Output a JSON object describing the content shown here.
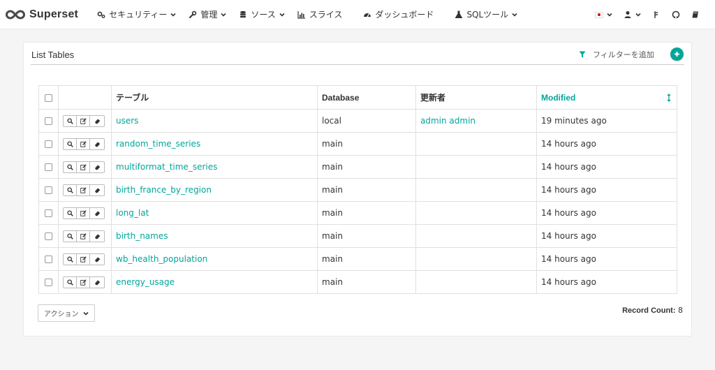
{
  "brand": {
    "name": "Superset",
    "color": "#484848"
  },
  "nav": {
    "items": [
      {
        "label": "セキュリティー",
        "icon": "gears-icon",
        "dropdown": true
      },
      {
        "label": "管理",
        "icon": "wrench-icon",
        "dropdown": true
      },
      {
        "label": "ソース",
        "icon": "database-icon",
        "dropdown": true
      },
      {
        "label": "スライス",
        "icon": "bar-chart-icon",
        "dropdown": false
      },
      {
        "label": "ダッシュボード",
        "icon": "dashboard-icon",
        "dropdown": false
      },
      {
        "label": "SQLツール",
        "icon": "flask-icon",
        "dropdown": true
      }
    ],
    "right": [
      {
        "icon": "japan-flag-icon",
        "dropdown": true
      },
      {
        "icon": "user-icon",
        "dropdown": true
      },
      {
        "icon": "version-icon",
        "dropdown": false
      },
      {
        "icon": "github-icon",
        "dropdown": false
      },
      {
        "icon": "book-icon",
        "dropdown": false
      }
    ]
  },
  "panel": {
    "title": "List Tables",
    "filter_label": "フィルターを追加",
    "add_icon": "plus-icon"
  },
  "table": {
    "columns": [
      "テーブル",
      "Database",
      "更新者",
      "Modified"
    ],
    "sorted_column": "Modified",
    "rows": [
      {
        "name": "users",
        "database": "local",
        "changed_by": "admin admin",
        "modified": "19 minutes ago"
      },
      {
        "name": "random_time_series",
        "database": "main",
        "changed_by": "",
        "modified": "14 hours ago"
      },
      {
        "name": "multiformat_time_series",
        "database": "main",
        "changed_by": "",
        "modified": "14 hours ago"
      },
      {
        "name": "birth_france_by_region",
        "database": "main",
        "changed_by": "",
        "modified": "14 hours ago"
      },
      {
        "name": "long_lat",
        "database": "main",
        "changed_by": "",
        "modified": "14 hours ago"
      },
      {
        "name": "birth_names",
        "database": "main",
        "changed_by": "",
        "modified": "14 hours ago"
      },
      {
        "name": "wb_health_population",
        "database": "main",
        "changed_by": "",
        "modified": "14 hours ago"
      },
      {
        "name": "energy_usage",
        "database": "main",
        "changed_by": "",
        "modified": "14 hours ago"
      }
    ],
    "row_action_icons": [
      "search-icon",
      "edit-icon",
      "eraser-icon"
    ]
  },
  "footer": {
    "action_label": "アクション",
    "record_count_label": "Record Count:",
    "record_count": "8"
  },
  "colors": {
    "accent": "#00a699",
    "text": "#333333",
    "background": "#f5f5f5"
  }
}
